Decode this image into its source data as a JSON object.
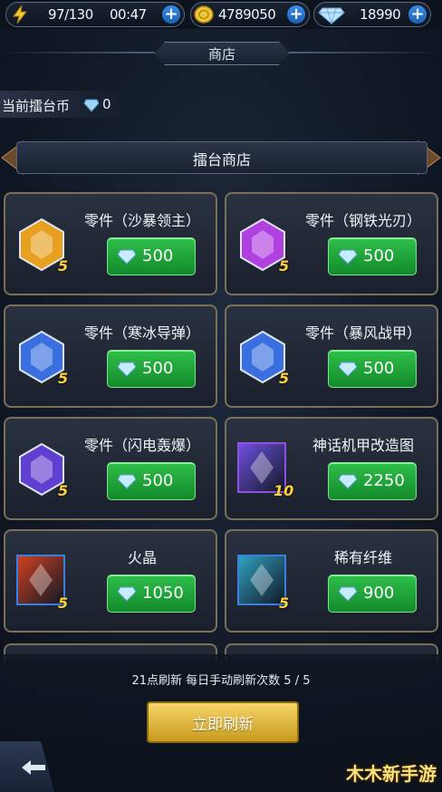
{
  "topbar": {
    "energy": "97/130",
    "timer": "00:47",
    "gold": "4789050",
    "diamonds": "18990"
  },
  "header": {
    "title": "商店"
  },
  "arena_coin": {
    "label": "当前擂台币",
    "value": "0"
  },
  "section": {
    "title": "擂台商店"
  },
  "items": [
    {
      "name": "零件（沙暴领主）",
      "price": "500",
      "qty": "5",
      "icon": "sand-lord-part-icon"
    },
    {
      "name": "零件（钢铁光刃）",
      "price": "500",
      "qty": "5",
      "icon": "steel-blade-part-icon"
    },
    {
      "name": "零件（寒冰导弹）",
      "price": "500",
      "qty": "5",
      "icon": "ice-missile-part-icon"
    },
    {
      "name": "零件（暴风战甲）",
      "price": "500",
      "qty": "5",
      "icon": "storm-armor-part-icon"
    },
    {
      "name": "零件（闪电轰爆）",
      "price": "500",
      "qty": "5",
      "icon": "lightning-blast-part-icon"
    },
    {
      "name": "神话机甲改造图",
      "price": "2250",
      "qty": "10",
      "icon": "mech-blueprint-icon"
    },
    {
      "name": "火晶",
      "price": "1050",
      "qty": "5",
      "icon": "fire-crystal-icon"
    },
    {
      "name": "稀有纤维",
      "price": "900",
      "qty": "5",
      "icon": "rare-fiber-icon"
    }
  ],
  "refresh": {
    "info": "21点刷新 每日手动刷新次数 5 / 5",
    "button": "立即刷新"
  },
  "watermark": "木木新手游",
  "colors": {
    "buy_green": "#2fbf4a",
    "refresh_gold": "#e8b93a",
    "card_border": "#7a6f58",
    "qty_yellow": "#ffd13a"
  }
}
